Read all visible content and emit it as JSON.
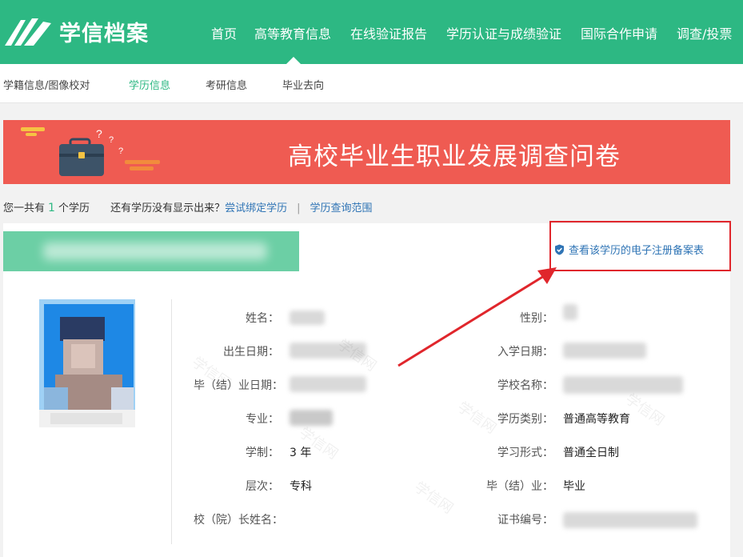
{
  "header": {
    "logo_text": "学信档案",
    "nav": [
      {
        "label": "首页"
      },
      {
        "label": "高等教育信息"
      },
      {
        "label": "在线验证报告"
      },
      {
        "label": "学历认证与成绩验证"
      },
      {
        "label": "国际合作申请"
      },
      {
        "label": "调查/投票"
      }
    ]
  },
  "subnav": {
    "items": [
      {
        "label": "学籍信息/图像校对"
      },
      {
        "label": "学历信息"
      },
      {
        "label": "考研信息"
      },
      {
        "label": "毕业去向"
      }
    ]
  },
  "banner": {
    "title": "高校毕业生职业发展调查问卷"
  },
  "summary": {
    "prefix": "您一共有",
    "count": "1",
    "suffix": "个学历",
    "question": "还有学历没有显示出来？",
    "bind_link": "尝试绑定学历",
    "sep": "|",
    "scope_link": "学历查询范围"
  },
  "card": {
    "record_link": "查看该学历的电子注册备案表",
    "watermark": "学信网",
    "fields_left": [
      {
        "label": "姓名：",
        "value": ""
      },
      {
        "label": "出生日期：",
        "value": ""
      },
      {
        "label": "毕（结）业日期：",
        "value": ""
      },
      {
        "label": "专业：",
        "value": ""
      },
      {
        "label": "学制：",
        "value": "3 年"
      },
      {
        "label": "层次：",
        "value": "专科"
      },
      {
        "label": "校（院）长姓名：",
        "value": ""
      }
    ],
    "fields_right": [
      {
        "label": "性别：",
        "value": ""
      },
      {
        "label": "入学日期：",
        "value": ""
      },
      {
        "label": "学校名称：",
        "value": ""
      },
      {
        "label": "学历类别：",
        "value": "普通高等教育"
      },
      {
        "label": "学习形式：",
        "value": "普通全日制"
      },
      {
        "label": "毕（结）业：",
        "value": "毕业"
      },
      {
        "label": "证书编号：",
        "value": ""
      }
    ]
  },
  "colors": {
    "brand_green": "#2db883",
    "banner_red": "#ef5b52",
    "link_blue": "#2f74b5",
    "highlight_red": "#e0262c"
  }
}
